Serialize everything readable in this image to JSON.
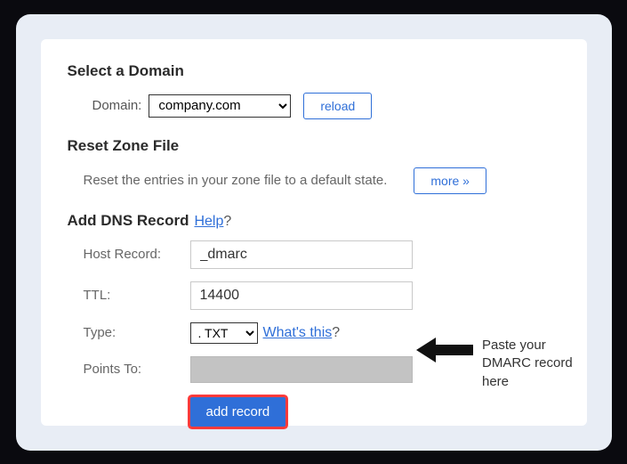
{
  "select_domain": {
    "title": "Select a Domain",
    "label": "Domain:",
    "value": "company.com",
    "reload_label": "reload"
  },
  "reset_zone": {
    "title": "Reset Zone File",
    "text": "Reset the entries in your zone file to a default state.",
    "more_label": "more »"
  },
  "add_record": {
    "title": "Add DNS Record",
    "help_label": "Help",
    "qmark": "?",
    "host_label": "Host Record:",
    "host_value": "_dmarc",
    "ttl_label": "TTL:",
    "ttl_value": "14400",
    "type_label": "Type:",
    "type_value": ". TXT",
    "whats_this": "What's this",
    "points_label": "Points To:",
    "points_value": "",
    "button_label": "add record"
  },
  "annotation": {
    "text": "Paste your DMARC record here"
  }
}
